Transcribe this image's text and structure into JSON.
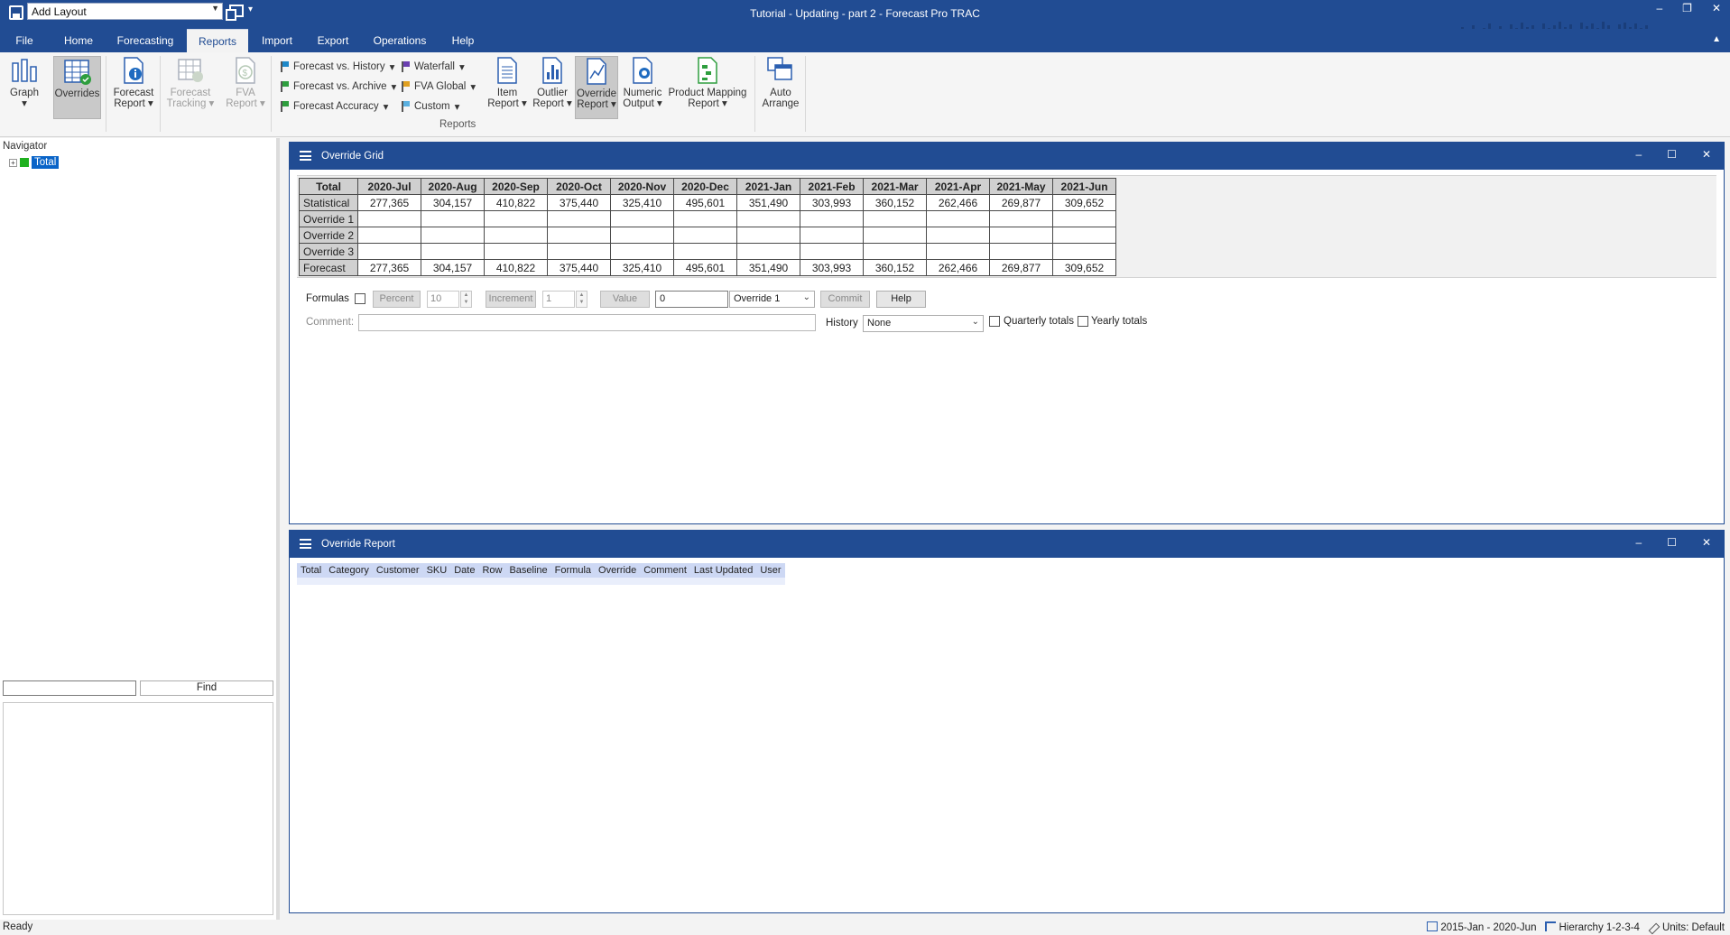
{
  "titlebar": {
    "layout_combo": "Add Layout",
    "app_title": "Tutorial - Updating - part 2 - Forecast Pro TRAC"
  },
  "menu": {
    "tabs": [
      "File",
      "Home",
      "Forecasting",
      "Reports",
      "Import",
      "Export",
      "Operations",
      "Help"
    ],
    "active": "Reports"
  },
  "ribbon": {
    "graph": "Graph",
    "overrides": "Overrides",
    "forecast_report": [
      "Forecast",
      "Report"
    ],
    "forecast_tracking": [
      "Forecast",
      "Tracking"
    ],
    "fva_report": [
      "FVA",
      "Report"
    ],
    "forecast_vs_history": "Forecast vs. History",
    "forecast_vs_archive": "Forecast vs. Archive",
    "forecast_accuracy": "Forecast Accuracy",
    "waterfall": "Waterfall",
    "fva_global": "FVA Global",
    "custom": "Custom",
    "item_report": [
      "Item",
      "Report"
    ],
    "outlier_report": [
      "Outlier",
      "Report"
    ],
    "override_report": [
      "Override",
      "Report"
    ],
    "numeric_output": [
      "Numeric",
      "Output"
    ],
    "product_mapping_report": [
      "Product Mapping",
      "Report"
    ],
    "auto_arrange": [
      "Auto",
      "Arrange"
    ],
    "group_label": "Reports",
    "flag_colors": {
      "forecast_vs_history": "#1e88c8",
      "forecast_vs_archive": "#2e9e3e",
      "forecast_accuracy": "#2e9e3e",
      "waterfall": "#6a3fb0",
      "fva_global": "#e0a020",
      "custom": "#5ab0e0"
    }
  },
  "navigator": {
    "title": "Navigator",
    "root_item": "Total",
    "find_label": "Find",
    "find_value": ""
  },
  "override_grid": {
    "title": "Override Grid",
    "corner": "Total",
    "columns": [
      "2020-Jul",
      "2020-Aug",
      "2020-Sep",
      "2020-Oct",
      "2020-Nov",
      "2020-Dec",
      "2021-Jan",
      "2021-Feb",
      "2021-Mar",
      "2021-Apr",
      "2021-May",
      "2021-Jun"
    ],
    "rows": [
      {
        "label": "Statistical",
        "values": [
          "277,365",
          "304,157",
          "410,822",
          "375,440",
          "325,410",
          "495,601",
          "351,490",
          "303,993",
          "360,152",
          "262,466",
          "269,877",
          "309,652"
        ]
      },
      {
        "label": "Override 1",
        "values": [
          "",
          "",
          "",
          "",
          "",
          "",
          "",
          "",
          "",
          "",
          "",
          ""
        ]
      },
      {
        "label": "Override 2",
        "values": [
          "",
          "",
          "",
          "",
          "",
          "",
          "",
          "",
          "",
          "",
          "",
          ""
        ]
      },
      {
        "label": "Override 3",
        "values": [
          "",
          "",
          "",
          "",
          "",
          "",
          "",
          "",
          "",
          "",
          "",
          ""
        ]
      },
      {
        "label": "Forecast",
        "values": [
          "277,365",
          "304,157",
          "410,822",
          "375,440",
          "325,410",
          "495,601",
          "351,490",
          "303,993",
          "360,152",
          "262,466",
          "269,877",
          "309,652"
        ]
      }
    ],
    "formulas_label": "Formulas",
    "percent_label": "Percent",
    "percent_value": "10",
    "increment_label": "Increment",
    "increment_value": "1",
    "value_label": "Value",
    "value_input": "0",
    "override_select": "Override 1",
    "commit_label": "Commit",
    "help_label": "Help",
    "comment_label": "Comment:",
    "comment_value": "",
    "history_label": "History",
    "history_select": "None",
    "quarterly_label": "Quarterly totals",
    "yearly_label": "Yearly totals"
  },
  "override_report": {
    "title": "Override Report",
    "columns": [
      "Total",
      "Category",
      "Customer",
      "SKU",
      "Date",
      "Row",
      "Baseline",
      "Formula",
      "Override",
      "Comment",
      "Last Updated",
      "User"
    ]
  },
  "status": {
    "ready": "Ready",
    "date_range": "2015-Jan - 2020-Jun",
    "hierarchy": "Hierarchy 1-2-3-4",
    "units": "Units: Default"
  }
}
